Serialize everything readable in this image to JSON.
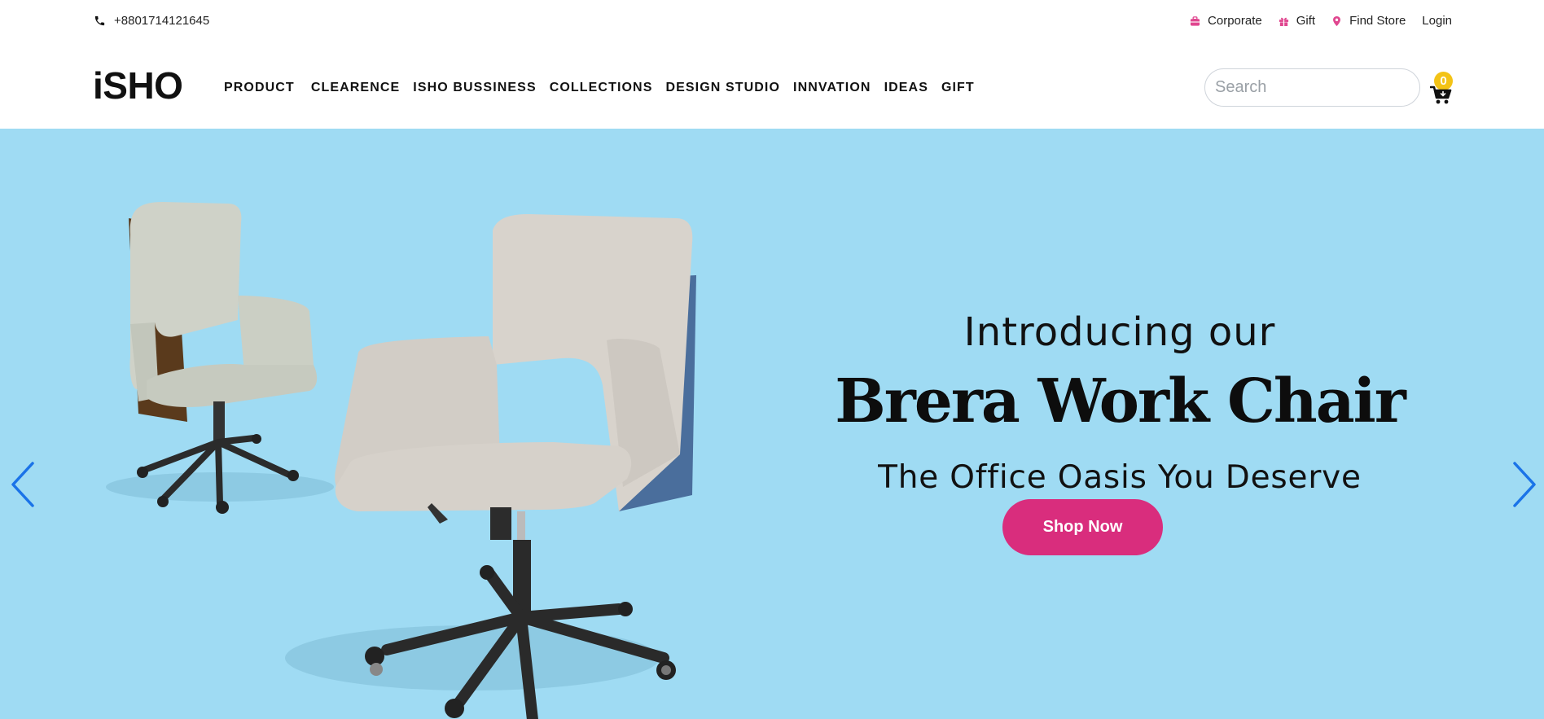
{
  "topbar": {
    "phone": "+8801714121645",
    "links": [
      {
        "label": "Corporate",
        "icon": "briefcase-icon"
      },
      {
        "label": "Gift",
        "icon": "gift-icon"
      },
      {
        "label": "Find Store",
        "icon": "map-pin-icon"
      },
      {
        "label": "Login"
      }
    ],
    "icon_color": "#e0468f"
  },
  "header": {
    "logo": "iSHO",
    "nav": [
      "PRODUCT",
      "CLEARENCE",
      "ISHO BUSSINESS",
      "COLLECTIONS",
      "DESIGN STUDIO",
      "INNVATION",
      "IDEAS",
      "GIFT"
    ],
    "search_placeholder": "Search",
    "cart_count": "0",
    "badge_color": "#f3c316"
  },
  "hero": {
    "line1": "Introducing our",
    "line2": "Brera Work Chair",
    "line3": "The Office Oasis You Deserve",
    "cta": "Shop Now",
    "background": "#9fdbf3",
    "cta_color": "#d92d7d",
    "arrow_color": "#1a73e8"
  }
}
